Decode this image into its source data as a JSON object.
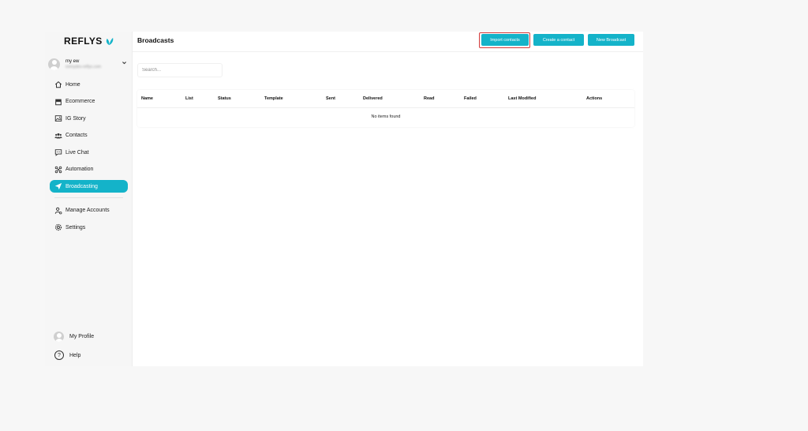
{
  "colors": {
    "accent": "#14b3c9",
    "highlight_outline": "#d43a3a",
    "background": "#f7f7f7"
  },
  "brand": {
    "name": "REFLYS",
    "logo_icon": "leaf-icon"
  },
  "account": {
    "name": "my ew",
    "subtitle": "reenydev-reflys.com",
    "chevron_icon": "chevron-down-icon"
  },
  "sidebar": {
    "items": [
      {
        "label": "Home",
        "icon": "home-icon",
        "active": false
      },
      {
        "label": "Ecommerce",
        "icon": "store-icon",
        "active": false
      },
      {
        "label": "IG Story",
        "icon": "image-icon",
        "active": false
      },
      {
        "label": "Contacts",
        "icon": "users-icon",
        "active": false
      },
      {
        "label": "Live Chat",
        "icon": "chat-icon",
        "active": false
      },
      {
        "label": "Automation",
        "icon": "automation-icon",
        "active": false
      },
      {
        "label": "Broadcasting",
        "icon": "send-icon",
        "active": true
      }
    ],
    "secondary": [
      {
        "label": "Manage Accounts",
        "icon": "user-settings-icon"
      },
      {
        "label": "Settings",
        "icon": "gear-icon"
      }
    ],
    "bottom": {
      "profile_label": "My Profile",
      "help_label": "Help",
      "help_glyph": "?"
    }
  },
  "header": {
    "title": "Broadcasts",
    "buttons": {
      "import": "Import contacts",
      "create": "Create a contact",
      "new": "New Broadcast"
    }
  },
  "search": {
    "placeholder": "Search..."
  },
  "table": {
    "columns": [
      "Name",
      "List",
      "Status",
      "Template",
      "Sent",
      "Delivered",
      "Read",
      "Failed",
      "Last Modified",
      "Actions"
    ],
    "empty_text": "No items found"
  }
}
